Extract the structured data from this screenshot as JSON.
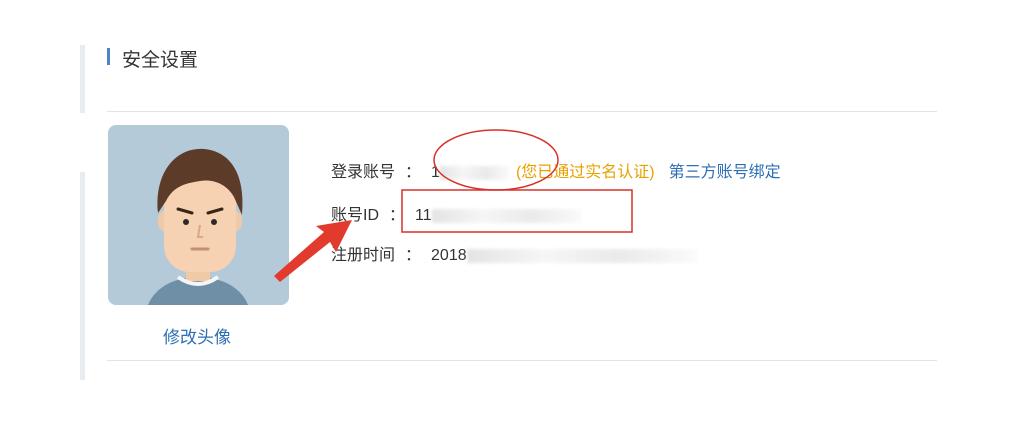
{
  "section": {
    "title": "安全设置"
  },
  "avatar": {
    "change_label": "修改头像"
  },
  "account": {
    "login_label": "登录账号",
    "login_value": "1",
    "verified_text": "(您已通过实名认证)",
    "third_party_link": "第三方账号绑定",
    "id_label": "账号ID",
    "id_value": "11",
    "register_label": "注册时间",
    "register_value": "2018",
    "colon": "："
  },
  "colors": {
    "accent": "#4a86c5",
    "link": "#2c6fb4",
    "warning": "#e8a200",
    "annotation": "#d9302a"
  }
}
